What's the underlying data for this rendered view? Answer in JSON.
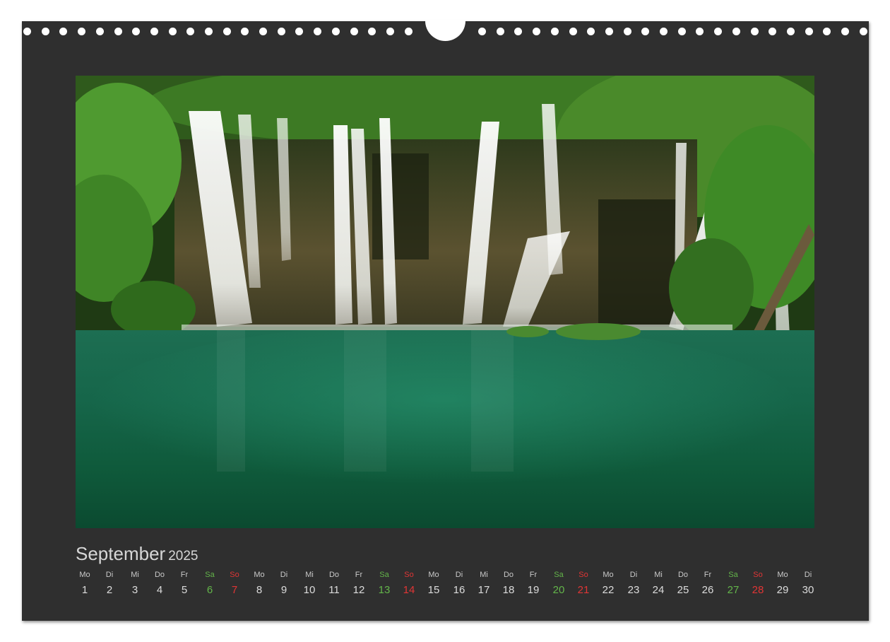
{
  "calendar": {
    "month": "September",
    "year": "2025",
    "colors": {
      "weekday": "#dcdcdc",
      "saturday": "#63b54a",
      "sunday": "#e03535",
      "background": "#2f2f2f"
    },
    "days": [
      {
        "wd": "Mo",
        "n": "1",
        "t": "wk"
      },
      {
        "wd": "Di",
        "n": "2",
        "t": "wk"
      },
      {
        "wd": "Mi",
        "n": "3",
        "t": "wk"
      },
      {
        "wd": "Do",
        "n": "4",
        "t": "wk"
      },
      {
        "wd": "Fr",
        "n": "5",
        "t": "wk"
      },
      {
        "wd": "Sa",
        "n": "6",
        "t": "sat"
      },
      {
        "wd": "So",
        "n": "7",
        "t": "sun"
      },
      {
        "wd": "Mo",
        "n": "8",
        "t": "wk"
      },
      {
        "wd": "Di",
        "n": "9",
        "t": "wk"
      },
      {
        "wd": "Mi",
        "n": "10",
        "t": "wk"
      },
      {
        "wd": "Do",
        "n": "11",
        "t": "wk"
      },
      {
        "wd": "Fr",
        "n": "12",
        "t": "wk"
      },
      {
        "wd": "Sa",
        "n": "13",
        "t": "sat"
      },
      {
        "wd": "So",
        "n": "14",
        "t": "sun"
      },
      {
        "wd": "Mo",
        "n": "15",
        "t": "wk"
      },
      {
        "wd": "Di",
        "n": "16",
        "t": "wk"
      },
      {
        "wd": "Mi",
        "n": "17",
        "t": "wk"
      },
      {
        "wd": "Do",
        "n": "18",
        "t": "wk"
      },
      {
        "wd": "Fr",
        "n": "19",
        "t": "wk"
      },
      {
        "wd": "Sa",
        "n": "20",
        "t": "sat"
      },
      {
        "wd": "So",
        "n": "21",
        "t": "sun"
      },
      {
        "wd": "Mo",
        "n": "22",
        "t": "wk"
      },
      {
        "wd": "Di",
        "n": "23",
        "t": "wk"
      },
      {
        "wd": "Mi",
        "n": "24",
        "t": "wk"
      },
      {
        "wd": "Do",
        "n": "25",
        "t": "wk"
      },
      {
        "wd": "Fr",
        "n": "26",
        "t": "wk"
      },
      {
        "wd": "Sa",
        "n": "27",
        "t": "sat"
      },
      {
        "wd": "So",
        "n": "28",
        "t": "sun"
      },
      {
        "wd": "Mo",
        "n": "29",
        "t": "wk"
      },
      {
        "wd": "Di",
        "n": "30",
        "t": "wk"
      }
    ]
  }
}
